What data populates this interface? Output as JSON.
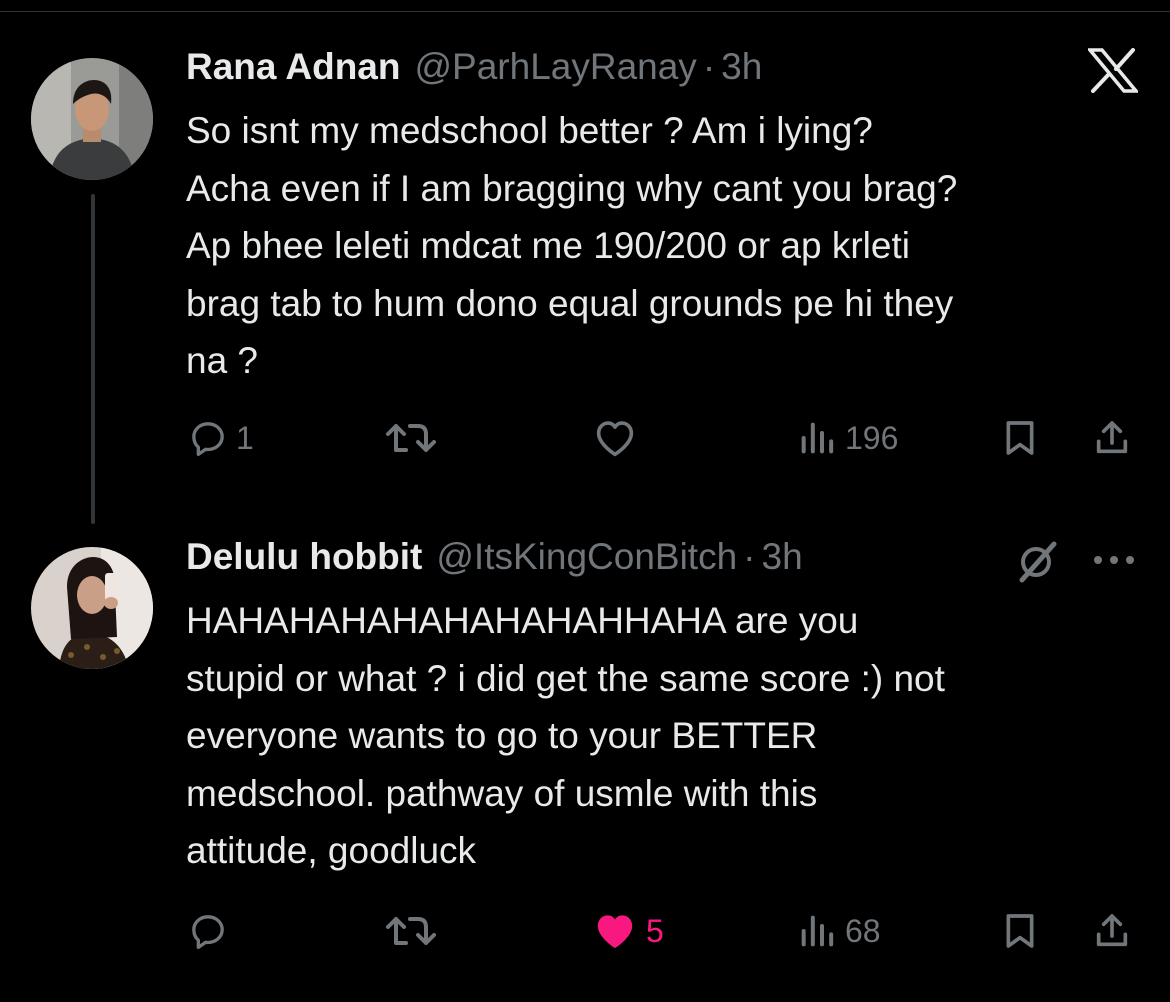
{
  "colors": {
    "background": "#000000",
    "text": "#e7e9ea",
    "muted": "#71767b",
    "like": "#f91880",
    "divider": "#2f3336"
  },
  "tweets": [
    {
      "name": "Rana Adnan",
      "handle": "@ParhLayRanay",
      "separator": "·",
      "time": "3h",
      "text": "So isnt my medschool better ? Am i lying?\nAcha even if I am bragging why cant you brag?\nAp bhee leleti mdcat me 190/200 or ap krleti\nbrag tab to hum dono equal grounds pe hi they\nna ?",
      "reply_count": "1",
      "retweet_count": "",
      "like_count": "",
      "liked": false,
      "views": "196",
      "header_icons": [
        "x-logo-icon"
      ]
    },
    {
      "name": "Delulu hobbit",
      "handle": "@ItsKingConBitch",
      "separator": "·",
      "time": "3h",
      "text": "HAHAHAHAHAHAHAHAHHAHA are you\nstupid or what ? i did get the same score :) not\neveryone wants to go to your BETTER\nmedschool. pathway of usmle with this\nattitude, goodluck",
      "reply_count": "",
      "retweet_count": "",
      "like_count": "5",
      "liked": true,
      "views": "68",
      "header_icons": [
        "grok-icon",
        "more-icon"
      ]
    }
  ]
}
